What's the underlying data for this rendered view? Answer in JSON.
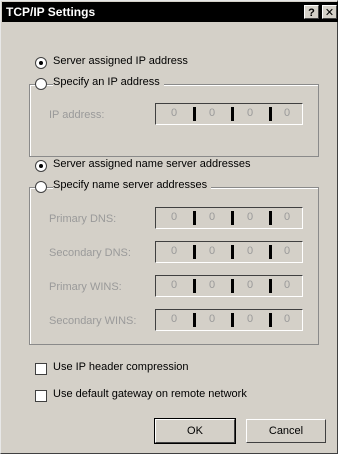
{
  "window": {
    "title": "TCP/IP Settings",
    "help_label": "?",
    "close_label": "✕"
  },
  "ip_section": {
    "server_assigned_label": "Server assigned IP address",
    "server_assigned_underline": "S",
    "specify_label": "Specify an IP address",
    "fields": [
      {
        "label": "IP address:",
        "octets": [
          "0",
          "0",
          "0",
          "0"
        ]
      }
    ]
  },
  "dns_section": {
    "server_assigned_label": "Server assigned name server addresses",
    "specify_label": "Specify name server addresses",
    "fields": [
      {
        "label": "Primary DNS:",
        "octets": [
          "0",
          "0",
          "0",
          "0"
        ]
      },
      {
        "label": "Secondary DNS:",
        "octets": [
          "0",
          "0",
          "0",
          "0"
        ]
      },
      {
        "label": "Primary WINS:",
        "octets": [
          "0",
          "0",
          "0",
          "0"
        ]
      },
      {
        "label": "Secondary WINS:",
        "octets": [
          "0",
          "0",
          "0",
          "0"
        ]
      }
    ]
  },
  "options": {
    "header_compression_label": "Use IP header compression",
    "default_gateway_label": "Use default gateway on remote network"
  },
  "buttons": {
    "ok_label": "OK",
    "cancel_label": "Cancel"
  }
}
